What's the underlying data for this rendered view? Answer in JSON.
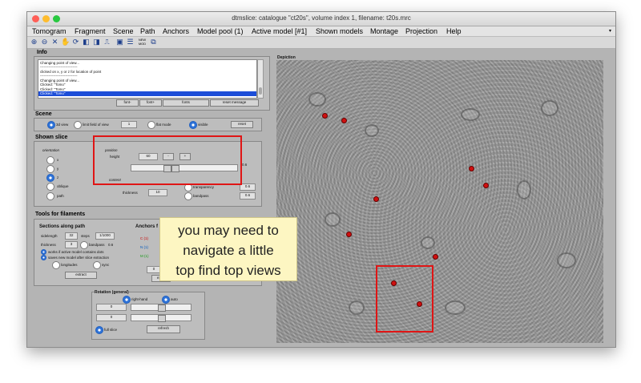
{
  "window": {
    "title": "dtmslice: catalogue \"ct20s\", volume index 1, filename: t20s.mrc"
  },
  "menu": [
    "Tomogram",
    "Fragment",
    "Scene",
    "Path",
    "Anchors",
    "Model pool (1)",
    "Active model [#1]",
    "Shown models",
    "Montage",
    "Projection",
    "Help"
  ],
  "toolbar": {
    "icons": [
      "zoom-in-icon",
      "zoom-out-icon",
      "fit-icon",
      "pan-icon",
      "rotate-icon",
      "contrast-icon",
      "invert-icon",
      "profile-icon",
      "save-icon",
      "stack-icon",
      "new-model-icon",
      "copy-icon"
    ],
    "new_model_label": "NEW\nMOD"
  },
  "info": {
    "title": "Info",
    "lines": [
      "Changing point of view...",
      "-------------------------------",
      "clicked on x, y or z for location of point",
      "-------------------------------",
      "Changing point of view...",
      "Clicked: \"Tomo\"",
      "Clicked: \"Tomo\"",
      "Clicked: \"Tomo\""
    ],
    "selected_line": "Clicked: \"Tomo\"",
    "buttons": [
      "font-",
      "font+",
      "fonts",
      "reset message"
    ]
  },
  "scene": {
    "title": "Scene",
    "view_3d": "3d view",
    "limit_label": "limit field of view",
    "limit_value": "1",
    "flat_mode": "flat mode",
    "visible": "visible",
    "reset": "reset"
  },
  "shown_slice": {
    "title": "Shown slice",
    "orientation_label": "orientation",
    "orientations": [
      "x",
      "y",
      "z",
      "oblique",
      "path"
    ],
    "position_label": "position",
    "height_label": "height",
    "height_value": "60",
    "minus": "-",
    "plus": "+",
    "content_label": "content",
    "thickness_label": "thickness",
    "thickness_value": "10",
    "transparency_label": "transparency",
    "transparency_value": "0.6",
    "bandpass_label": "bandpass",
    "bandpass_value": "0.6",
    "side_value_1": "0.6"
  },
  "tools": {
    "title": "Tools for filaments",
    "sections_label": "Sections along path",
    "sidelength_label": "sidelength",
    "sidelength_value": "32",
    "steps_label": "steps",
    "steps_value": "1/1000",
    "thickness_label": "thickness",
    "thickness_value": "3",
    "bandpass_label": "bandpass",
    "bandpass_value": "0.6",
    "option1": "works if active model contains dots",
    "option2": "saves new model after slice extraction",
    "longitudes": "longitudes",
    "sync": "sync",
    "extract": "extract",
    "anchors_label": "Anchors f",
    "anchor_c": "C (1)",
    "anchor_n": "N (1)",
    "anchor_m": "M (1)",
    "anchor_field": "0",
    "anchor_btn": "extra"
  },
  "rotation": {
    "title": "Rotation (general)",
    "right_hand": "right-hand",
    "auto": "auto",
    "value1": "0",
    "value2": "0",
    "full_slice": "full slice",
    "refresh": "refresh"
  },
  "depiction": {
    "title": "Depiction"
  },
  "tooltip": {
    "line1": "you may need to",
    "line2": "navigate a little",
    "line3": "top find top views"
  },
  "colors": {
    "highlight": "#e01515",
    "accent": "#2f73d8",
    "tooltip_bg": "#fdf6c2",
    "point": "#d01010"
  }
}
